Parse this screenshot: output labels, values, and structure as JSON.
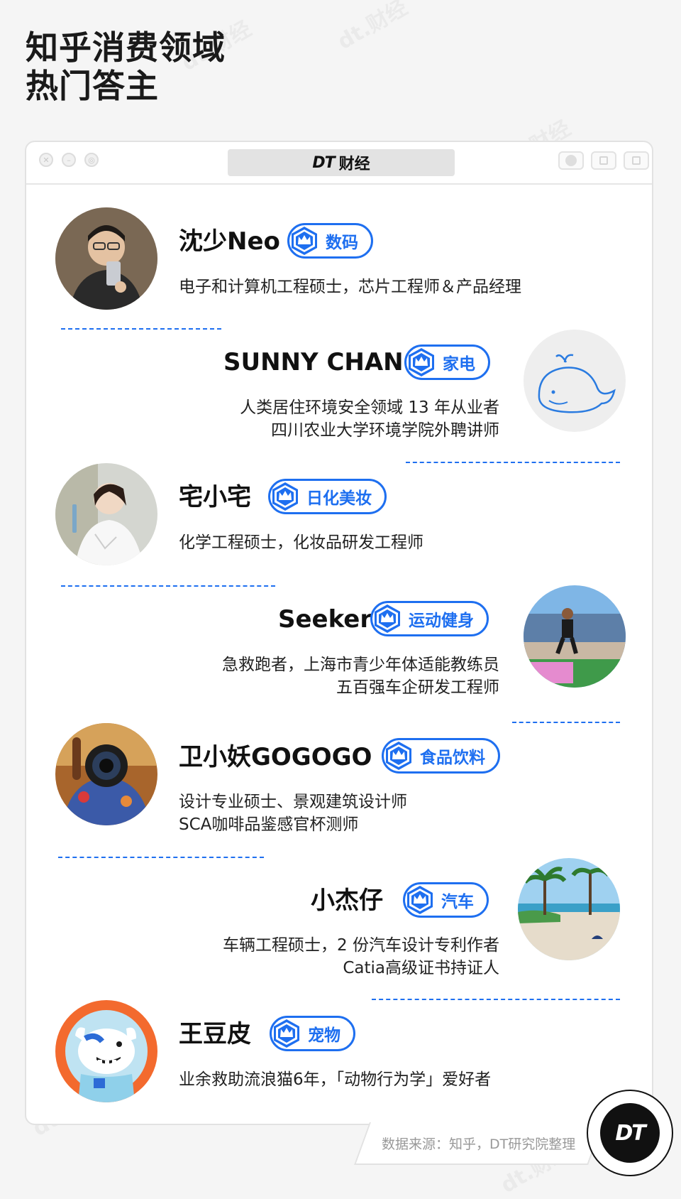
{
  "title": {
    "line1": "知乎消费领域",
    "line2": "热门答主"
  },
  "window": {
    "logo_text": "DT",
    "title_text": "财经"
  },
  "watermark": "dt.财经",
  "accent_color": "#1e6ff0",
  "people": [
    {
      "name": "沈少Neo",
      "tag": "数码",
      "desc": [
        "电子和计算机工程硕士，芯片工程师＆产品经理"
      ]
    },
    {
      "name": "SUNNY CHAN",
      "tag": "家电",
      "desc": [
        "人类居住环境安全领域 13 年从业者",
        "四川农业大学环境学院外聘讲师"
      ]
    },
    {
      "name": "宅小宅",
      "tag": "日化美妆",
      "desc": [
        "化学工程硕士，化妆品研发工程师"
      ]
    },
    {
      "name": "Seeker",
      "tag": "运动健身",
      "desc": [
        "急救跑者，上海市青少年体适能教练员",
        "五百强车企研发工程师"
      ]
    },
    {
      "name": "卫小妖GOGOGO",
      "tag": "食品饮料",
      "desc": [
        "设计专业硕士、景观建筑设计师",
        "SCA咖啡品鉴感官杯测师"
      ]
    },
    {
      "name": "小杰仔",
      "tag": "汽车",
      "desc": [
        "车辆工程硕士，2 份汽车设计专利作者",
        "Catia高级证书持证人"
      ]
    },
    {
      "name": "王豆皮",
      "tag": "宠物",
      "desc": [
        "业余救助流浪猫6年，「动物行为学」爱好者"
      ]
    }
  ],
  "source": "数据来源：知乎，DT研究院整理",
  "corner_logo": "DT"
}
